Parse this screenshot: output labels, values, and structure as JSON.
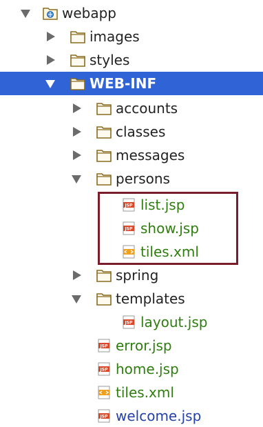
{
  "tree": {
    "webapp": {
      "label": "webapp",
      "icon": "web-folder-icon"
    },
    "images": {
      "label": "images",
      "icon": "folder-icon"
    },
    "styles": {
      "label": "styles",
      "icon": "folder-icon"
    },
    "web_inf": {
      "label": "WEB-INF",
      "icon": "folder-icon",
      "selected": true
    },
    "accounts": {
      "label": "accounts",
      "icon": "folder-icon"
    },
    "classes": {
      "label": "classes",
      "icon": "folder-icon"
    },
    "messages": {
      "label": "messages",
      "icon": "folder-icon"
    },
    "persons": {
      "label": "persons",
      "icon": "folder-icon"
    },
    "list_jsp": {
      "label": "list.jsp",
      "icon": "jsp-file-icon"
    },
    "show_jsp": {
      "label": "show.jsp",
      "icon": "jsp-file-icon"
    },
    "tiles_xml_persons": {
      "label": "tiles.xml",
      "icon": "xml-file-icon"
    },
    "spring": {
      "label": "spring",
      "icon": "folder-icon"
    },
    "templates": {
      "label": "templates",
      "icon": "folder-icon"
    },
    "layout_jsp": {
      "label": "layout.jsp",
      "icon": "jsp-file-icon"
    },
    "error_jsp": {
      "label": "error.jsp",
      "icon": "jsp-file-icon"
    },
    "home_jsp": {
      "label": "home.jsp",
      "icon": "jsp-file-icon"
    },
    "tiles_xml": {
      "label": "tiles.xml",
      "icon": "xml-file-icon"
    },
    "welcome_jsp": {
      "label": "welcome.jsp",
      "icon": "jsp-file-icon"
    }
  },
  "colors": {
    "selection": "#2f63d6",
    "highlight_border": "#7a1d2a",
    "file_green": "#2e7d0f",
    "file_blue": "#2341a8"
  }
}
